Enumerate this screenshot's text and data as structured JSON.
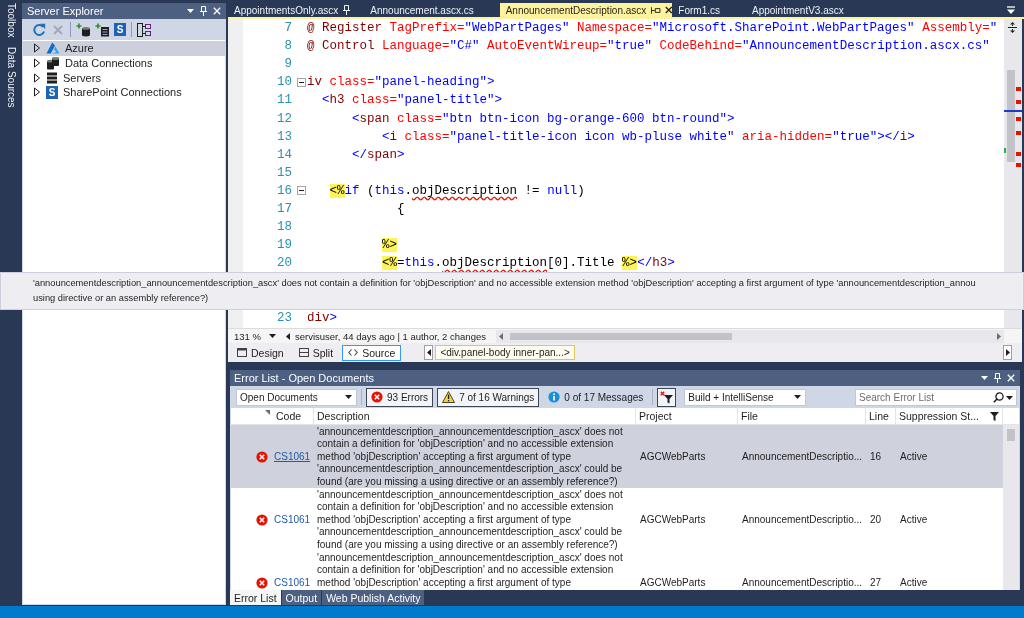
{
  "side_tabs": [
    {
      "label": "Toolbox"
    },
    {
      "label": "Data Sources"
    }
  ],
  "server_explorer": {
    "title": "Server Explorer",
    "toolbar_groups": [
      [
        {
          "kind": "refresh",
          "disabled": false
        },
        {
          "kind": "stop",
          "disabled": true
        }
      ],
      [
        {
          "kind": "add-database",
          "disabled": false
        },
        {
          "kind": "add-server",
          "disabled": false
        },
        {
          "kind": "letter-tile",
          "glyph": "S",
          "disabled": false
        }
      ],
      [
        {
          "kind": "diagram",
          "disabled": false
        }
      ]
    ],
    "tree": [
      {
        "kind": "cloud",
        "label": "Azure",
        "expanded": false,
        "selected": true
      },
      {
        "kind": "database",
        "label": "Data Connections",
        "expanded": false,
        "selected": false
      },
      {
        "kind": "servers",
        "label": "Servers",
        "expanded": false,
        "selected": false
      },
      {
        "kind": "letter-tile",
        "glyph": "S",
        "label": "SharePoint Connections",
        "expanded": false,
        "selected": false
      }
    ]
  },
  "document_tabs": [
    {
      "label": "AppointmentsOnly.ascx",
      "pinned": true,
      "selected": false
    },
    {
      "label": "Announcement.ascx.cs",
      "pinned": false,
      "selected": false
    },
    {
      "label": "AnnouncementDescription.ascx",
      "pinned": false,
      "selected": true
    },
    {
      "label": "Form1.cs",
      "pinned": false,
      "selected": false
    },
    {
      "label": "AppointmentV3.ascx",
      "pinned": false,
      "selected": false
    }
  ],
  "editor": {
    "lines": [
      {
        "number": "7",
        "collapsible": false,
        "tokens": [
          {
            "kind": "directive",
            "text": "@ Register"
          },
          {
            "kind": "attr",
            "text": " TagPrefix="
          },
          {
            "kind": "value",
            "text": "\"WebPartPages\""
          },
          {
            "kind": "attr",
            "text": " Namespace="
          },
          {
            "kind": "value",
            "text": "\"Microsoft.SharePoint.WebPartPages\""
          },
          {
            "kind": "attr",
            "text": " Assembly="
          },
          {
            "kind": "value",
            "text": "\""
          }
        ]
      },
      {
        "number": "8",
        "collapsible": false,
        "tokens": [
          {
            "kind": "directive",
            "text": "@ Control"
          },
          {
            "kind": "attr",
            "text": " Language="
          },
          {
            "kind": "value",
            "text": "\"C#\""
          },
          {
            "kind": "attr",
            "text": " AutoEventWireup="
          },
          {
            "kind": "value",
            "text": "\"true\""
          },
          {
            "kind": "attr",
            "text": " CodeBehind="
          },
          {
            "kind": "value",
            "text": "\"AnnouncementDescription.ascx.cs\""
          }
        ]
      },
      {
        "number": "9",
        "collapsible": false
      },
      {
        "number": "10",
        "collapsible": true,
        "tokens": [
          {
            "kind": "tag",
            "text": "iv"
          },
          {
            "kind": "attr",
            "text": " class="
          },
          {
            "kind": "value",
            "text": "\"panel-heading\""
          },
          {
            "kind": "punct",
            "text": ">"
          }
        ]
      },
      {
        "number": "11",
        "collapsible": false,
        "tokens": [
          {
            "kind": "punct",
            "text": "  <"
          },
          {
            "kind": "tag",
            "text": "h3"
          },
          {
            "kind": "attr",
            "text": " class="
          },
          {
            "kind": "value",
            "text": "\"panel-title\""
          },
          {
            "kind": "punct",
            "text": ">"
          }
        ]
      },
      {
        "number": "12",
        "collapsible": false,
        "tokens": [
          {
            "kind": "punct",
            "text": "      <"
          },
          {
            "kind": "tag",
            "text": "span"
          },
          {
            "kind": "attr",
            "text": " class="
          },
          {
            "kind": "value",
            "text": "\"btn btn-icon bg-orange-600 btn-round\""
          },
          {
            "kind": "punct",
            "text": ">"
          }
        ]
      },
      {
        "number": "13",
        "collapsible": false,
        "tokens": [
          {
            "kind": "punct",
            "text": "          <"
          },
          {
            "kind": "tag",
            "text": "i"
          },
          {
            "kind": "attr",
            "text": " class="
          },
          {
            "kind": "value",
            "text": "\"panel-title-icon icon wb-pluse white\""
          },
          {
            "kind": "attr",
            "text": " aria-hidden="
          },
          {
            "kind": "value",
            "text": "\"true\""
          },
          {
            "kind": "punct",
            "text": "></"
          },
          {
            "kind": "tag",
            "text": "i"
          },
          {
            "kind": "punct",
            "text": ">"
          }
        ]
      },
      {
        "number": "14",
        "collapsible": false,
        "tokens": [
          {
            "kind": "punct",
            "text": "      </"
          },
          {
            "kind": "tag",
            "text": "span"
          },
          {
            "kind": "punct",
            "text": ">"
          }
        ]
      },
      {
        "number": "15",
        "collapsible": false
      },
      {
        "number": "16",
        "collapsible": true,
        "tokens": [
          {
            "kind": "delim",
            "text": "   <%"
          },
          {
            "kind": "keyword",
            "text": "if"
          },
          {
            "kind": "plain",
            "text": " ("
          },
          {
            "kind": "keyword",
            "text": "this"
          },
          {
            "kind": "plain",
            "text": "."
          },
          {
            "kind": "error",
            "text": "objDescription"
          },
          {
            "kind": "plain",
            "text": " != "
          },
          {
            "kind": "keyword",
            "text": "null"
          },
          {
            "kind": "plain",
            "text": ")"
          }
        ]
      },
      {
        "number": "17",
        "collapsible": false,
        "tokens": [
          {
            "kind": "plain",
            "text": "            {"
          }
        ]
      },
      {
        "number": "18",
        "collapsible": false
      },
      {
        "number": "19",
        "collapsible": false,
        "tokens": [
          {
            "kind": "delim",
            "text": "          %>"
          }
        ]
      },
      {
        "number": "20",
        "collapsible": false,
        "tokens": [
          {
            "kind": "delim",
            "text": "          <%"
          },
          {
            "kind": "plain",
            "text": "="
          },
          {
            "kind": "keyword",
            "text": "this"
          },
          {
            "kind": "plain",
            "text": "."
          },
          {
            "kind": "error",
            "text": "objDescription"
          },
          {
            "kind": "plain",
            "text": "[0].Title "
          },
          {
            "kind": "delim",
            "text": "%>"
          },
          {
            "kind": "punct",
            "text": "</"
          },
          {
            "kind": "tag",
            "text": "h3"
          },
          {
            "kind": "punct",
            "text": ">"
          }
        ]
      },
      {
        "number": "23",
        "collapsible": false,
        "tokens": [
          {
            "kind": "tag",
            "text": "div"
          },
          {
            "kind": "punct",
            "text": ">"
          }
        ]
      }
    ],
    "zoom": "131 %",
    "codelens": "servisuser, 44 days ago | 1 author, 2 changes"
  },
  "tooltip": {
    "lines": [
      "'announcementdescription_announcementdescription_ascx' does not contain a definition for 'objDescription' and no accessible extension method 'objDescription' accepting a first argument of type 'announcementdescription_annou",
      "using directive or an assembly reference?)"
    ]
  },
  "view_switch": {
    "modes": [
      {
        "kind": "design",
        "label": "Design",
        "selected": false
      },
      {
        "kind": "split",
        "label": "Split",
        "selected": false
      },
      {
        "kind": "source",
        "label": "Source",
        "selected": true
      }
    ],
    "breadcrumb": "<div.panel-body inner-pan...>"
  },
  "error_list": {
    "title": "Error List - Open Documents",
    "scope": "Open Documents",
    "filters": [
      {
        "kind": "error",
        "label": "93 Errors",
        "selected": true
      },
      {
        "kind": "warning",
        "label": "7 of 16 Warnings",
        "selected": true
      },
      {
        "kind": "message",
        "label": "0 of 17 Messages",
        "selected": false
      }
    ],
    "filter_toggle": {
      "on": true
    },
    "build_source": "Build + IntelliSense",
    "search": {
      "placeholder": "Search Error List"
    },
    "columns": [
      "Code",
      "Description",
      "Project",
      "File",
      "Line",
      "Suppression St..."
    ],
    "rows": [
      {
        "kind": "error",
        "code": "CS1061",
        "description": "'announcementdescription_announcementdescription_ascx' does not contain a definition for 'objDescription' and no accessible extension method 'objDescription' accepting a first argument of type 'announcementdescription_announcementdescription_ascx' could be found (are you missing a using directive or an assembly reference?)",
        "project": "AGCWebParts",
        "file": "AnnouncementDescriptio...",
        "line": "16",
        "suppression": "Active",
        "selected": true
      },
      {
        "kind": "error",
        "code": "CS1061",
        "description": "'announcementdescription_announcementdescription_ascx' does not contain a definition for 'objDescription' and no accessible extension method 'objDescription' accepting a first argument of type 'announcementdescription_announcementdescription_ascx' could be found (are you missing a using directive or an assembly reference?)",
        "project": "AGCWebParts",
        "file": "AnnouncementDescriptio...",
        "line": "20",
        "suppression": "Active",
        "selected": false
      },
      {
        "kind": "error",
        "code": "CS1061",
        "description": "'announcementdescription_announcementdescription_ascx' does not contain a definition for 'objDescription' and no accessible extension method 'objDescription' accepting a first argument of type",
        "project": "AGCWebParts",
        "file": "AnnouncementDescriptio...",
        "line": "27",
        "suppression": "Active",
        "selected": false
      }
    ]
  },
  "bottom_tabs": [
    {
      "label": "Error List",
      "selected": true
    },
    {
      "label": "Output",
      "selected": false
    },
    {
      "label": "Web Publish Activity",
      "selected": false
    }
  ]
}
